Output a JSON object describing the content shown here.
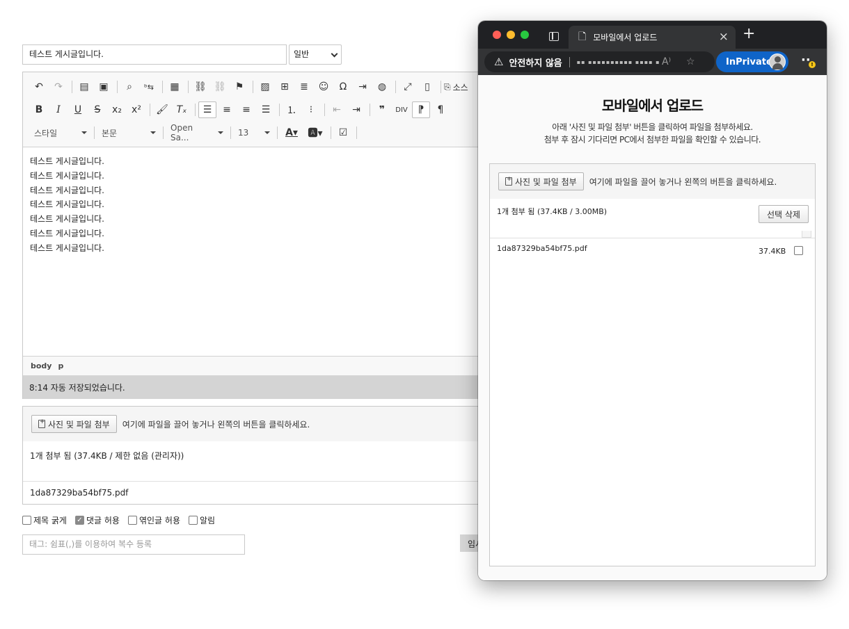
{
  "editor_page": {
    "title_value": "테스트 게시글입니다.",
    "category_selected": "일반",
    "toolbar": {
      "source_label": "소스",
      "style_combo": "스타일",
      "format_combo": "본문",
      "font_combo": "Open Sa...",
      "size_combo": "13"
    },
    "content_lines": [
      "테스트 게시글입니다.",
      "테스트 게시글입니다.",
      "테스트 게시글입니다.",
      "테스트 게시글입니다.",
      "테스트 게시글입니다.",
      "테스트 게시글입니다.",
      "테스트 게시글입니다."
    ],
    "path": [
      "body",
      "p"
    ],
    "autosave_text": "8:14 자동 저장되었습니다.",
    "uploader": {
      "attach_button": "사진 및 파일 첨부",
      "hint": "여기에 파일을 끌어 놓거나 왼쪽의 버튼을 클릭하세요.",
      "status": "1개 첨부 됨 (37.4KB / 제한 없음 (관리자))",
      "file_name": "1da87329ba54bf75.pdf"
    },
    "options": [
      {
        "label": "제목 굵게",
        "checked": false
      },
      {
        "label": "댓글 허용",
        "checked": true
      },
      {
        "label": "엮인글 허용",
        "checked": false
      },
      {
        "label": "알림",
        "checked": false
      }
    ],
    "tags_placeholder": "태그: 쉼표(,)를 이용하여 복수 등록",
    "temp_save_label": "임시"
  },
  "popup": {
    "tab_title": "모바일에서 업로드",
    "address_warning": "안전하지 않음",
    "address_masked": "▪▪ ▪▪▪▪▪▪▪▪▪▪ ▪▪▪▪ ▪",
    "inprivate_label": "InPrivate",
    "badge": "!",
    "heading": "모바일에서 업로드",
    "desc_line1": "아래 '사진 및 파일 첨부' 버튼을 클릭하여 파일을 첨부하세요.",
    "desc_line2": "첨부 후 잠시 기다리면 PC에서 첨부한 파일을 확인할 수 있습니다.",
    "attach_button": "사진 및 파일 첨부",
    "hint": "여기에 파일을 끌어 놓거나 왼쪽의 버튼을 클릭하세요.",
    "status": "1개 첨부 됨 (37.4KB / 3.00MB)",
    "delete_button": "선택 삭제",
    "file_name": "1da87329ba54bf75.pdf",
    "file_size": "37.4KB"
  },
  "colors": {
    "inprivate_blue": "#0f64c8",
    "window_dark": "#202124",
    "autosave_bg": "#d4d4d4"
  }
}
